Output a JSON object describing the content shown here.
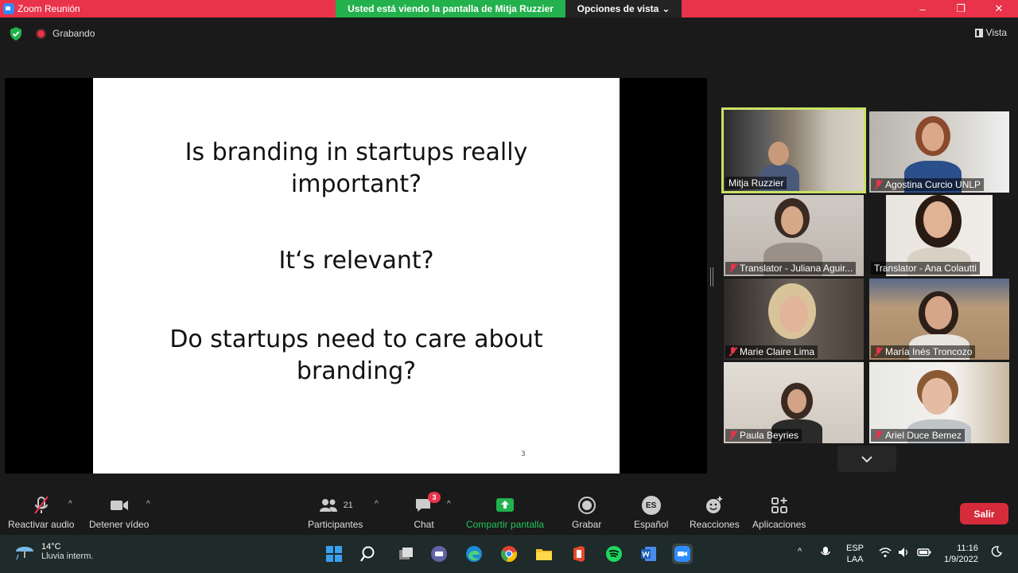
{
  "window": {
    "title": "Zoom Reunión",
    "share_banner": "Usted está viendo la pantalla de Mitja Ruzzier",
    "view_options": "Opciones de vista",
    "controls": [
      "–",
      "❐",
      "✕"
    ]
  },
  "meeting": {
    "recording_label": "Grabando",
    "view_label": "Vista"
  },
  "slide": {
    "question1": "Is branding in startups really important?",
    "question2": "It‘s relevant?",
    "question3": "Do startups need to care about branding?",
    "page_number": "3"
  },
  "participants": [
    {
      "name": "Mitja Ruzzier",
      "muted": false,
      "active": true
    },
    {
      "name": "Agostina Curcio UNLP",
      "muted": true,
      "active": false
    },
    {
      "name": "Translator - Juliana Aguir...",
      "muted": true,
      "active": false
    },
    {
      "name": "Translator - Ana Colautti",
      "muted": false,
      "active": false
    },
    {
      "name": "Marie Claire Lima",
      "muted": true,
      "active": false
    },
    {
      "name": "María Inés Troncozo",
      "muted": true,
      "active": false
    },
    {
      "name": "Paula Beyries",
      "muted": true,
      "active": false
    },
    {
      "name": "Ariel Duce Bemez",
      "muted": true,
      "active": false
    }
  ],
  "toolbar": {
    "unmute": "Reactivar audio",
    "stop_video": "Detener vídeo",
    "participants": "Participantes",
    "participants_count": "21",
    "chat": "Chat",
    "chat_badge": "3",
    "share": "Compartir pantalla",
    "record": "Grabar",
    "language": "Español",
    "language_code": "ES",
    "reactions": "Reacciones",
    "apps": "Aplicaciones",
    "leave": "Salir"
  },
  "taskbar": {
    "temp": "14°C",
    "weather": "Lluvia interm.",
    "lang1": "ESP",
    "lang2": "LAA",
    "time": "11:16",
    "date": "1/9/2022"
  },
  "colors": {
    "title_bar": "#e8334a",
    "share_banner": "#22b14c",
    "active_speaker": "#c9e265",
    "leave_button": "#d62b3a"
  }
}
